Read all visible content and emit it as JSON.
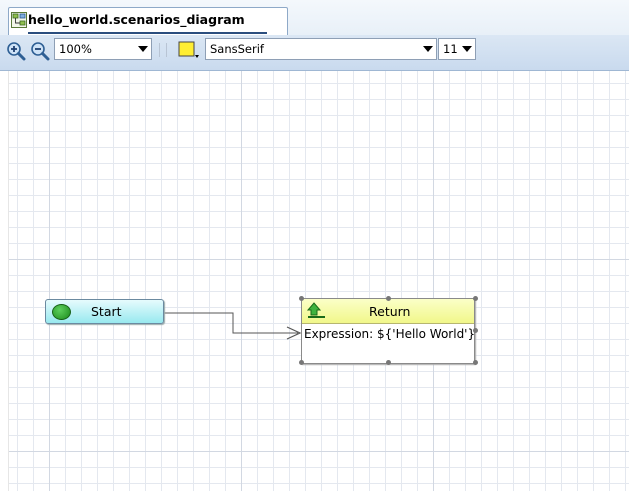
{
  "editor": {
    "tab_title": "hello_world.scenarios_diagram",
    "tab_icon": "diagram-icon"
  },
  "toolbar": {
    "zoom_in_icon": "zoom-in-icon",
    "zoom_out_icon": "zoom-out-icon",
    "zoom_value": "100%",
    "fill_color_icon": "fill-color-icon",
    "font_family": "SansSerif",
    "font_size": "11"
  },
  "diagram": {
    "start_node": {
      "label": "Start",
      "icon": "start-circle-icon",
      "color": "#98e9ef"
    },
    "return_node": {
      "label": "Return",
      "icon": "return-arrow-icon",
      "expression": "Expression: ${'Hello World'}",
      "color": "#f1f78a"
    }
  }
}
